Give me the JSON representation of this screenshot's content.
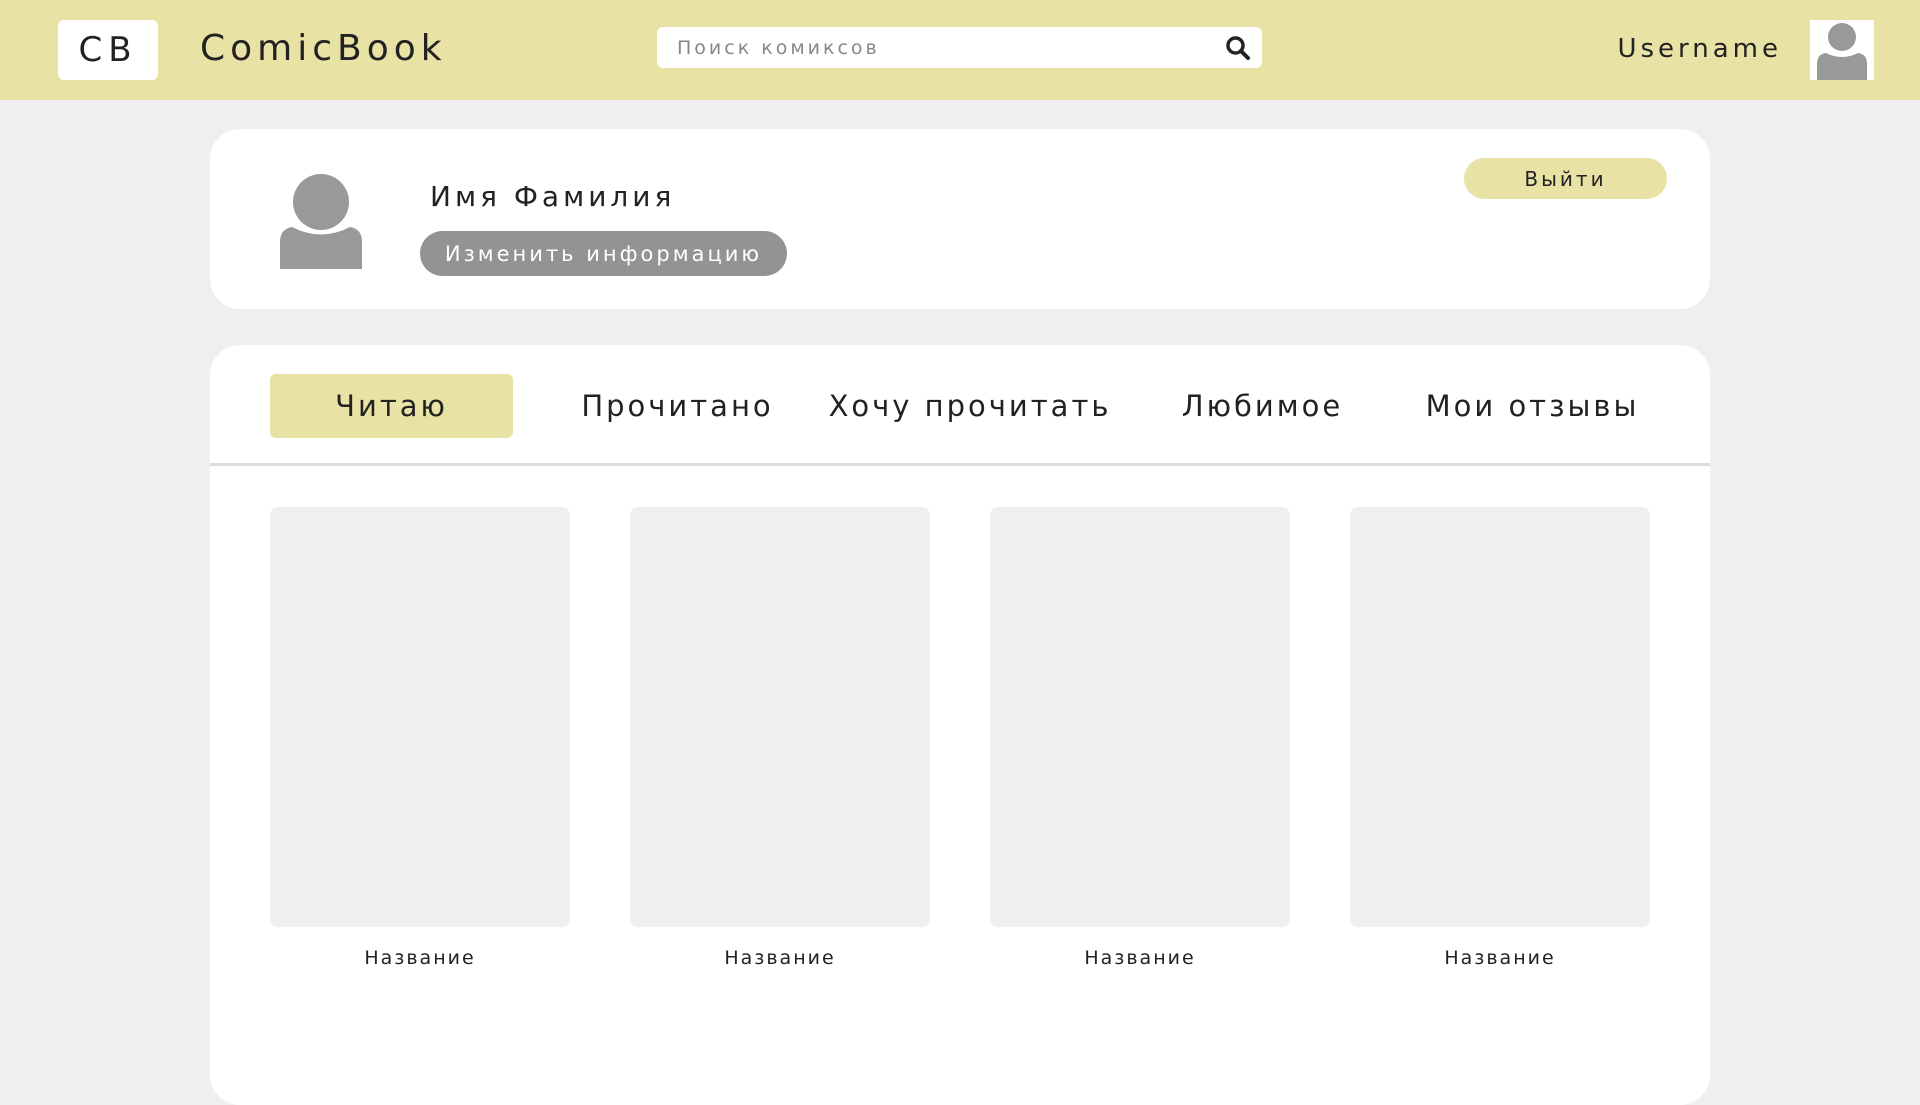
{
  "header": {
    "logo": "CB",
    "app_title": "ComicBook",
    "search": {
      "placeholder": "Поиск комиксов",
      "value": "",
      "icon": "search-icon"
    },
    "username": "Username",
    "avatar_icon": "user-icon"
  },
  "profile": {
    "name": "Имя Фамилия",
    "edit_label": "Изменить информацию",
    "logout_label": "Выйти",
    "avatar_icon": "user-icon"
  },
  "tabs": [
    {
      "label": "Читаю",
      "active": true
    },
    {
      "label": "Прочитано",
      "active": false
    },
    {
      "label": "Хочу прочитать",
      "active": false
    },
    {
      "label": "Любимое",
      "active": false
    },
    {
      "label": "Мои отзывы",
      "active": false
    }
  ],
  "comics": [
    {
      "title": "Название"
    },
    {
      "title": "Название"
    },
    {
      "title": "Название"
    },
    {
      "title": "Название"
    }
  ],
  "colors": {
    "accent": "#e8e2a5",
    "background": "#efefef",
    "button_gray": "#939393",
    "avatar_gray": "#999999"
  }
}
